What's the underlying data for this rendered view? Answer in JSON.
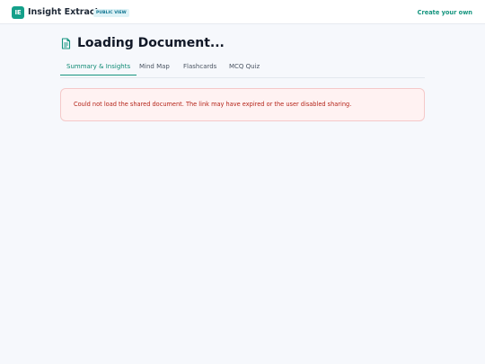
{
  "header": {
    "logo_text": "IE",
    "app_title": "Insight Extractor",
    "badge": "PUBLIC VIEW",
    "create_link": "Create your own"
  },
  "page": {
    "title": "Loading Document..."
  },
  "tabs": [
    {
      "label": "Summary & Insights",
      "active": true
    },
    {
      "label": "Mind Map",
      "active": false
    },
    {
      "label": "Flashcards",
      "active": false
    },
    {
      "label": "MCQ Quiz",
      "active": false
    }
  ],
  "error": {
    "message": "Could not load the shared document. The link may have expired or the user disabled sharing."
  },
  "colors": {
    "accent": "#15957f",
    "error_text": "#b42318",
    "error_bg": "#fff2f2"
  },
  "icons": {
    "logo": "ie-logo",
    "document": "document-icon"
  }
}
